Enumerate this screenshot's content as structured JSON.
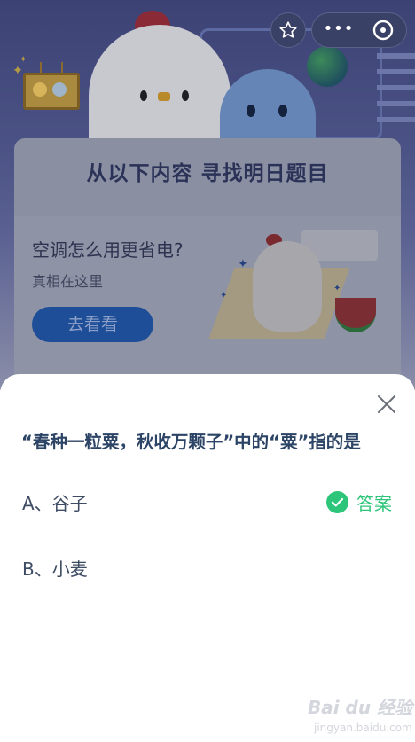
{
  "background": {
    "card_title": "从以下内容 寻找明日题目",
    "ad": {
      "title": "空调怎么用更省电?",
      "subtitle": "真相在这里",
      "button_label": "去看看"
    }
  },
  "top_bar": {
    "favorite_icon": "star-outline-icon",
    "more_icon": "more-dots-icon",
    "more_label": "•••",
    "close_icon": "close-circle-icon"
  },
  "sheet": {
    "close_icon": "close-x-icon",
    "question": "“春种一粒粟，秋收万颗子”中的“粟”指的是",
    "options": [
      {
        "label": "A、谷子",
        "is_answer": true
      },
      {
        "label": "B、小麦",
        "is_answer": false
      }
    ],
    "answer_label": "答案",
    "answer_color": "#2dc57a"
  },
  "watermark": {
    "text": "Bai du 经验",
    "sub": "jingyan.baidu.com"
  }
}
